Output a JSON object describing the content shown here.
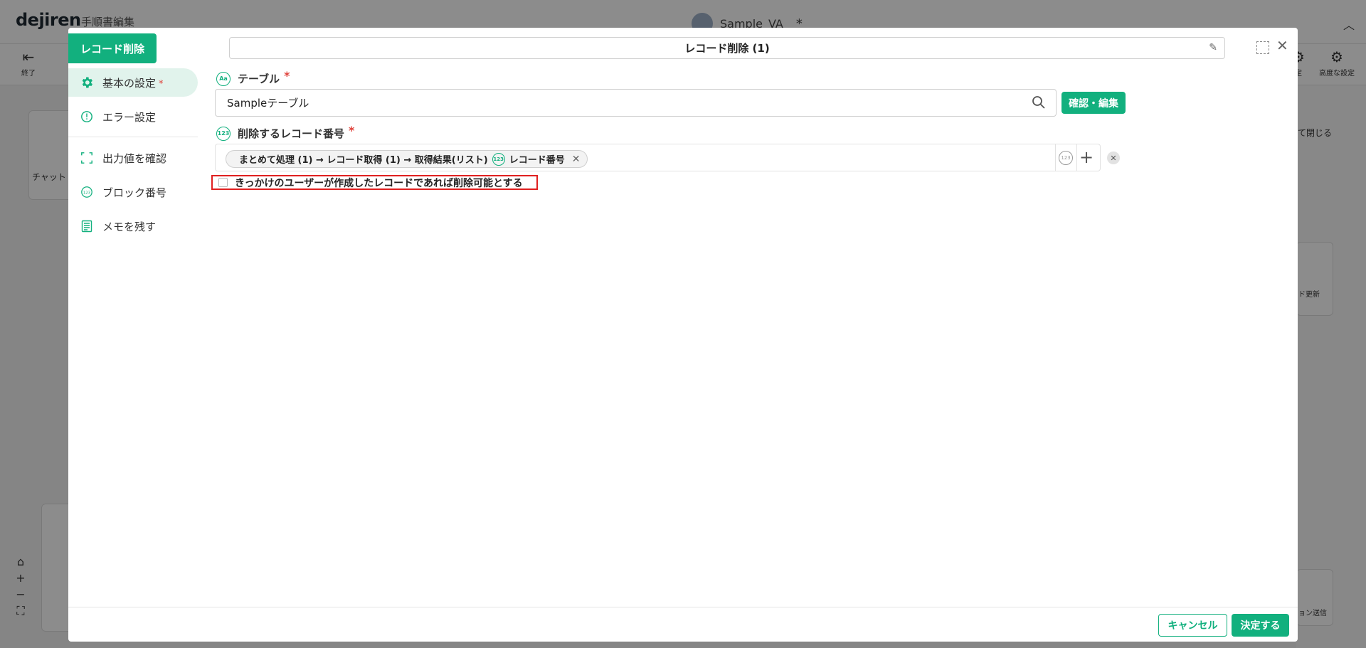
{
  "background": {
    "logo": "dejiren",
    "subtitle": "手順書編集",
    "project_name": "Sample_VA",
    "project_star": "*",
    "tools": {
      "exit": "終了",
      "settings": "定",
      "advanced": "高度な設定"
    },
    "side_card_label": "チャット",
    "right_panel": {
      "close_label": "て閉じる",
      "card_label": "ド更新",
      "card_label_2": "ョン送信"
    }
  },
  "modal": {
    "block_tag": "レコード削除",
    "title": "レコード削除 (1)",
    "sidebar": {
      "items": [
        {
          "label": "基本の設定",
          "required": "*"
        },
        {
          "label": "エラー設定"
        },
        {
          "label": "出力値を確認"
        },
        {
          "label": "ブロック番号"
        },
        {
          "label": "メモを残す"
        }
      ]
    },
    "table_field": {
      "label": "テーブル",
      "required": "*",
      "value": "Sampleテーブル",
      "confirm_button": "確認・編集"
    },
    "record_field": {
      "label": "削除するレコード番号",
      "required": "*",
      "chip_path": "まとめて処理 (1) → レコード取得 (1) → 取得結果(リスト)",
      "chip_value": "レコード番号"
    },
    "checkbox": {
      "label": "きっかけのユーザーが作成したレコードであれば削除可能とする",
      "checked": false
    },
    "footer": {
      "cancel": "キャンセル",
      "ok": "決定する"
    }
  },
  "colors": {
    "accent": "#12b07e",
    "danger": "#e02020",
    "required": "#e0413a"
  }
}
